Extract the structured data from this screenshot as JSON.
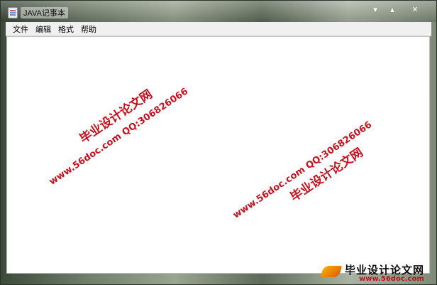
{
  "window": {
    "title": "JAVA记事本",
    "controls": {
      "minimize": "▾",
      "maximize": "▴",
      "close": "✕"
    }
  },
  "menubar": {
    "items": [
      {
        "label": "文件"
      },
      {
        "label": "编辑"
      },
      {
        "label": "格式"
      },
      {
        "label": "帮助"
      }
    ]
  },
  "editor": {
    "content": ""
  },
  "watermarks": [
    {
      "site_name": "毕业设计论文网",
      "line2": "www.56doc.com    QQ:306826066"
    },
    {
      "site_name": "毕业设计论文网",
      "line2": "www.56doc.com    QQ:306826066"
    }
  ],
  "brand": {
    "name": "毕业设计论文网",
    "url": "www.56doc.com"
  },
  "colors": {
    "watermark_red": "#c1121f",
    "menubar_bg": "#f0f0f0"
  }
}
